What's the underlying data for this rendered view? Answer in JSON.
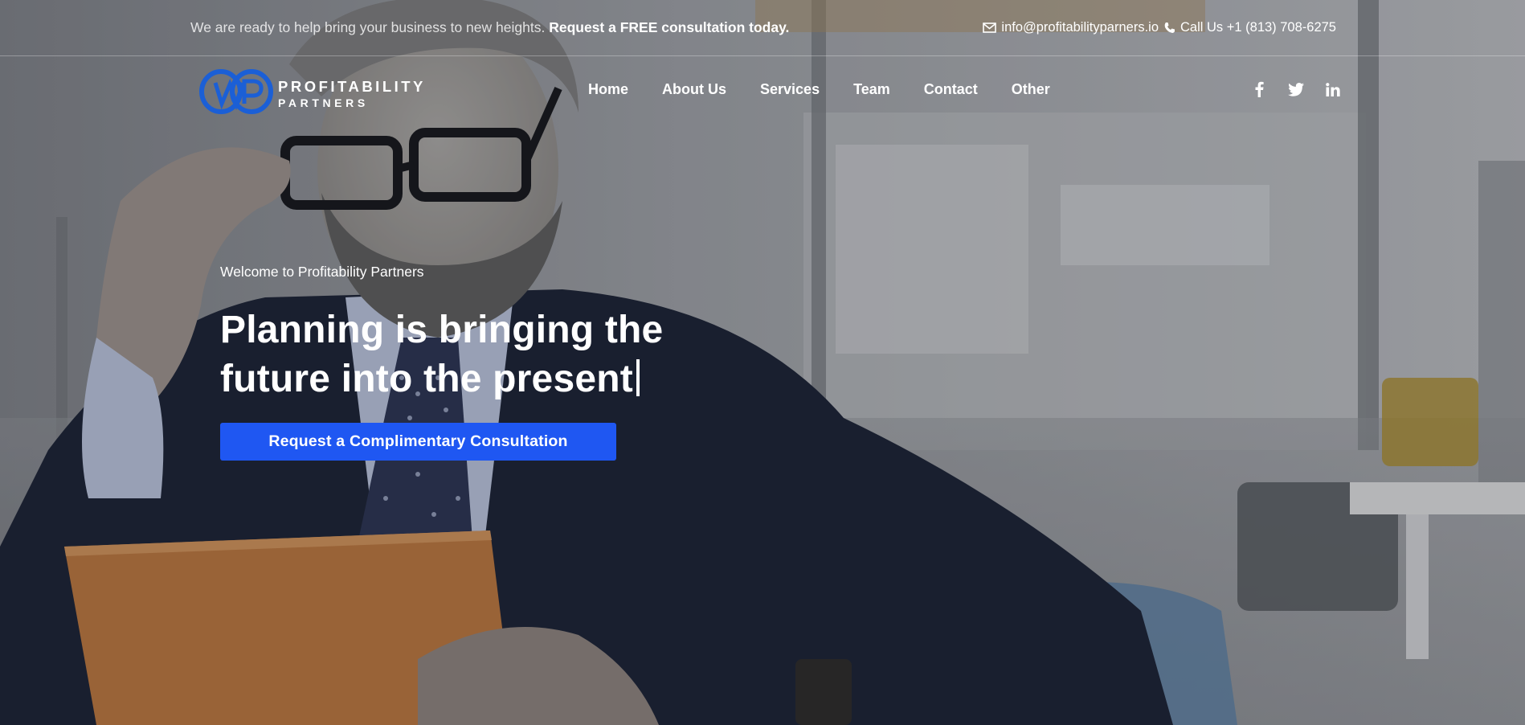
{
  "topbar": {
    "message_prefix": "We are ready to help bring your business to new heights.",
    "message_strong": "Request a FREE consultation today.",
    "email": "info@profitabilityparners.io",
    "phone": "Call Us +1 (813) 708-6275",
    "email_icon": "envelope-icon",
    "phone_icon": "phone-icon"
  },
  "brand": {
    "line1": "PROFITABILITY",
    "line2": "PARTNERS",
    "logo_color": "#1b5fd6"
  },
  "nav": {
    "items": [
      "Home",
      "About Us",
      "Services",
      "Team",
      "Contact",
      "Other"
    ]
  },
  "social": {
    "icons": [
      "facebook-icon",
      "twitter-icon",
      "linkedin-icon"
    ]
  },
  "hero": {
    "eyebrow": "Welcome to Profitability Partners",
    "headline_line1": "Planning is bringing the",
    "headline_line2": "future into the present",
    "cta_label": "Request a Complimentary Consultation",
    "cta_color": "#1f57f2"
  }
}
